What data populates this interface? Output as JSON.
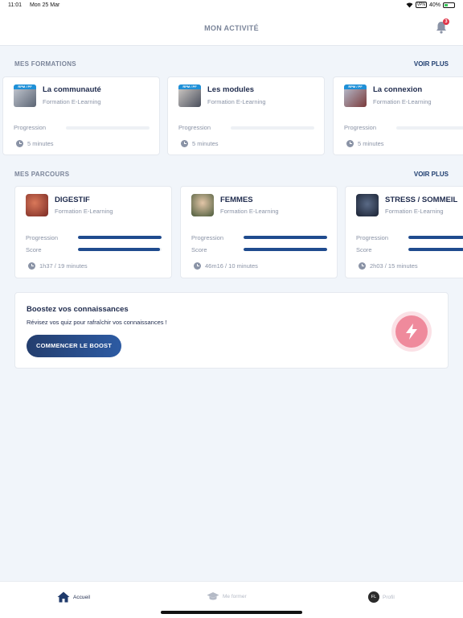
{
  "status_bar": {
    "time": "11:01",
    "date": "Mon 25 Mar",
    "vpn": "VPN",
    "battery": "40%",
    "battery_level": 0.4
  },
  "header": {
    "title": "MON ACTIVITÉ",
    "notification_count": "3"
  },
  "formations": {
    "title": "MES FORMATIONS",
    "more": "VOIR PLUS",
    "cards": [
      {
        "title": "La communauté",
        "subtitle": "Formation E-Learning",
        "thumb_tag": "RPM / PF",
        "progress_label": "Progression",
        "progress": 0,
        "duration": "5 minutes"
      },
      {
        "title": "Les modules",
        "subtitle": "Formation E-Learning",
        "thumb_tag": "RPM / PF",
        "progress_label": "Progression",
        "progress": 0,
        "duration": "5 minutes"
      },
      {
        "title": "La connexion",
        "subtitle": "Formation E-Learning",
        "thumb_tag": "RPM / PF",
        "progress_label": "Progression",
        "progress": 0,
        "duration": "5 minutes"
      }
    ]
  },
  "parcours": {
    "title": "MES PARCOURS",
    "more": "VOIR PLUS",
    "cards": [
      {
        "title": "DIGESTIF",
        "subtitle": "Formation E-Learning",
        "progress_label": "Progression",
        "score_label": "Score",
        "progress": 1.0,
        "score": 0.98,
        "duration": "1h37 / 19 minutes"
      },
      {
        "title": "FEMMES",
        "subtitle": "Formation E-Learning",
        "progress_label": "Progression",
        "score_label": "Score",
        "progress": 1.0,
        "score": 1.0,
        "duration": "46m16 / 10 minutes"
      },
      {
        "title": "STRESS / SOMMEIL",
        "subtitle": "Formation E-Learning",
        "progress_label": "Progression",
        "score_label": "Score",
        "progress": 1.0,
        "score": 1.0,
        "duration": "2h03 / 15 minutes"
      }
    ]
  },
  "boost": {
    "title": "Boostez vos connaissances",
    "subtitle": "Révisez vos quiz pour rafraîchir vos connaissances !",
    "button": "COMMENCER LE BOOST",
    "icon": "lightning-icon"
  },
  "tabbar": {
    "tabs": [
      {
        "label": "Accueil",
        "icon": "home-icon",
        "active": true
      },
      {
        "label": "Me former",
        "icon": "graduation-cap-icon",
        "active": false
      },
      {
        "label": "Profil",
        "icon": "avatar",
        "initials": "FL",
        "active": false
      }
    ]
  },
  "colors": {
    "accent": "#1f4b8e",
    "background": "#f1f5fa",
    "boost_icon": "#ef8a9c",
    "badge": "#e0364a"
  }
}
